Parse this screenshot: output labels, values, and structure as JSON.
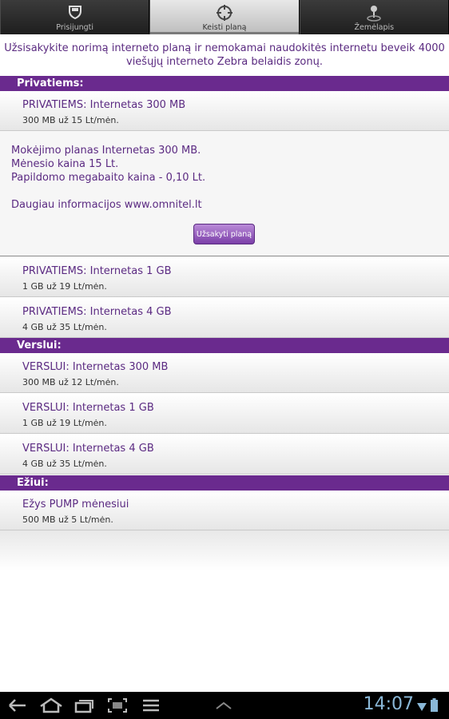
{
  "tabs": [
    {
      "label": "Prisijungti",
      "icon": "shield-icon",
      "active": false
    },
    {
      "label": "Keisti planą",
      "icon": "target-icon",
      "active": true
    },
    {
      "label": "Žemėlapis",
      "icon": "map-pin-icon",
      "active": false
    }
  ],
  "intro": "Užsisakykite norimą interneto planą ir nemokamai naudokitės internetu beveik 4000 viešųjų interneto Zebra belaidis zonų.",
  "sections": {
    "privatiems": {
      "header": "Privatiems:",
      "items": [
        {
          "title": "PRIVATIEMS: Internetas 300 MB",
          "sub": "300 MB už 15 Lt/mėn."
        },
        {
          "title": "PRIVATIEMS: Internetas 1 GB",
          "sub": "1 GB už 19 Lt/mėn."
        },
        {
          "title": "PRIVATIEMS: Internetas 4 GB",
          "sub": "4 GB už 35 Lt/mėn."
        }
      ]
    },
    "verslui": {
      "header": "Verslui:",
      "items": [
        {
          "title": "VERSLUI: Internetas 300 MB",
          "sub": "300 MB už 12 Lt/mėn."
        },
        {
          "title": "VERSLUI: Internetas 1 GB",
          "sub": "1 GB už 19 Lt/mėn."
        },
        {
          "title": "VERSLUI: Internetas 4 GB",
          "sub": "4 GB už 35 Lt/mėn."
        }
      ]
    },
    "eziui": {
      "header": "Ežiui:",
      "items": [
        {
          "title": "Ežys PUMP mėnesiui",
          "sub": "500 MB už 5 Lt/mėn."
        }
      ]
    }
  },
  "details": {
    "line1": "Mokėjimo planas Internetas 300 MB.",
    "line2": "Mėnesio kaina 15 Lt.",
    "line3": "Papildomo megabaito kaina - 0,10 Lt.",
    "line4": "Daugiau informacijos www.omnitel.lt",
    "button": "Užsakyti planą"
  },
  "system_bar": {
    "time": "14:07",
    "icons": [
      "back-icon",
      "home-icon",
      "recent-apps-icon",
      "screenshot-icon",
      "menu-icon",
      "up-chevron-icon",
      "wifi-icon",
      "battery-icon"
    ]
  },
  "colors": {
    "accent": "#6a2a8e",
    "text_purple": "#5b2a82"
  }
}
